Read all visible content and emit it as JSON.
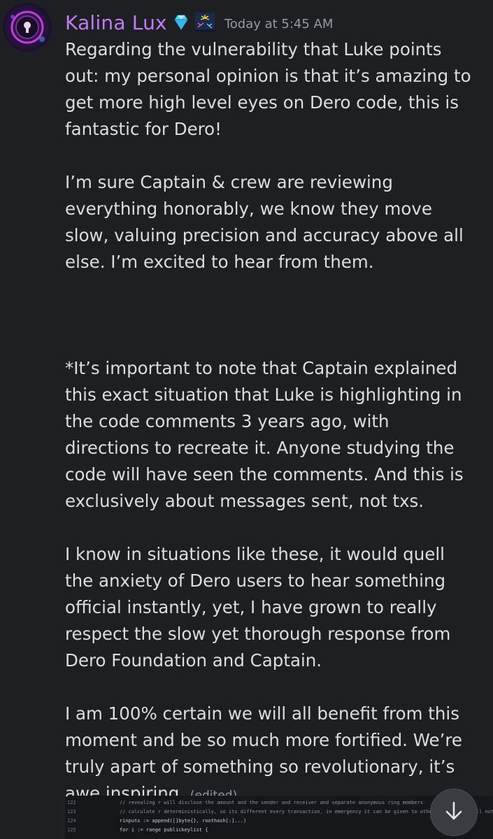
{
  "message": {
    "author": "Kalina Lux",
    "badges": [
      "gem-icon",
      "fireworks-icon"
    ],
    "timestamp": "Today at 5:45 AM",
    "paragraphs": [
      "Regarding the vulnerability that Luke points out: my personal opinion is that it’s amazing to get more high level eyes on Dero code, this is fantastic for Dero!",
      "I’m sure Captain & crew are reviewing everything honorably, we know they move slow, valuing precision and accuracy above all else.  I’m excited to hear from them.",
      "*It’s important to note that Captain explained this exact situation that Luke is highlighting in the code comments 3 years ago, with directions to recreate it. Anyone studying the code will have seen the comments. And this is exclusively about messages sent, not txs.",
      "I know in situations like these, it would quell the anxiety of Dero users to hear something official instantly, yet, I have grown to really respect the slow yet thorough response from Dero Foundation and Captain.",
      "I am 100% certain we will all benefit from this moment and be so much more fortified. We’re truly apart of something so revolutionary, it’s awe inspiring."
    ],
    "edited_label": "(edited)"
  },
  "attachment": {
    "lines": [
      {
        "num": "122",
        "text": "//  revealing r will disclose the amount and the sender and receiver and separate anonymous ring members",
        "kind": "comment"
      },
      {
        "num": "123",
        "text": "// calculate r deterministically, so its different every transaction, in emergency it can be given to other, and still will not a",
        "kind": "comment"
      },
      {
        "num": "124",
        "text": "rinputs := append([]byte{}, roothash[:]...)",
        "kind": "code"
      },
      {
        "num": "125",
        "text": "for i := range publickeylist {",
        "kind": "code"
      }
    ]
  },
  "scroll_button": {
    "icon": "arrow-down-icon"
  },
  "colors": {
    "background": "#1e1f22",
    "username": "#c27af6",
    "text": "#dbdee1",
    "muted": "#949ba4"
  }
}
